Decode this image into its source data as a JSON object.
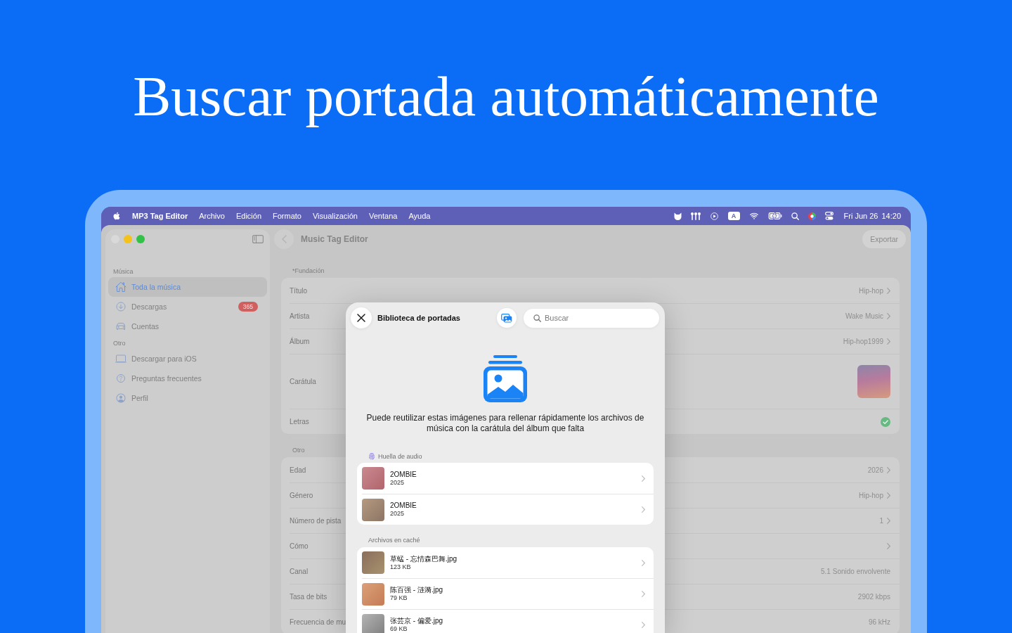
{
  "headline": "Buscar portada automáticamente",
  "menu_bar": {
    "app_name": "MP3 Tag Editor",
    "menus": [
      "Archivo",
      "Edición",
      "Formato",
      "Visualización",
      "Ventana",
      "Ayuda"
    ],
    "input_source": "A",
    "date": "Fri Jun 26",
    "time": "14:20"
  },
  "window": {
    "traffic_lights": [
      {
        "disabled": true
      },
      {
        "disabled": false
      },
      {
        "disabled": false
      }
    ],
    "title": "Music Tag Editor",
    "export_button": {
      "label": "Exportar",
      "disabled": true
    }
  },
  "sidebar": {
    "sections": [
      {
        "heading": "Música",
        "items": [
          {
            "label": "Toda la música",
            "selected": true
          },
          {
            "label": "Descargas",
            "selected": false,
            "badge": "365"
          },
          {
            "label": "Cuentas",
            "selected": false
          }
        ]
      },
      {
        "heading": "Otro",
        "items": [
          {
            "label": "Descargar para iOS",
            "selected": false
          },
          {
            "label": "Preguntas frecuentes",
            "selected": false
          },
          {
            "label": "Perfil",
            "selected": false
          }
        ]
      }
    ]
  },
  "form": {
    "sections": [
      {
        "heading": "*Fundación",
        "rows": [
          {
            "label": "Título",
            "kind": "link",
            "value": "Hip-hop"
          },
          {
            "label": "Artista",
            "kind": "link",
            "value": "Wake Music"
          },
          {
            "label": "Álbum",
            "kind": "link",
            "value": "Hip-hop1999"
          },
          {
            "label": "Carátula",
            "kind": "cover"
          },
          {
            "label": "Letras",
            "kind": "check"
          }
        ]
      },
      {
        "heading": "Otro",
        "rows": [
          {
            "label": "Edad",
            "kind": "link",
            "value": "2026"
          },
          {
            "label": "Género",
            "kind": "link",
            "value": "Hip-hop"
          },
          {
            "label": "Número de pista",
            "kind": "link",
            "value": "1"
          },
          {
            "label": "Cómo",
            "kind": "link"
          },
          {
            "label": "Canal",
            "kind": "value",
            "value": "5.1 Sonido envolvente"
          },
          {
            "label": "Tasa de bits",
            "kind": "value",
            "value": "2902 kbps"
          },
          {
            "label": "Frecuencia de mu",
            "kind": "value",
            "value": "96 kHz"
          }
        ]
      }
    ]
  },
  "cover_library": {
    "title": "Biblioteca de portadas",
    "search": {
      "placeholder": "Buscar"
    },
    "description": "Puede reutilizar estas imágenes para rellenar rápidamente los archivos de música con la carátula del álbum que falta",
    "sections": [
      {
        "heading": "Huella de audio",
        "kind": "match",
        "items": [
          {
            "title": "2OMBIE",
            "subtitle": "2025"
          },
          {
            "title": "2OMBIE",
            "subtitle": "2025"
          }
        ]
      },
      {
        "heading": "Archivos en caché",
        "kind": "cache",
        "items": [
          {
            "title": "草蜢 - 忘情森巴舞.jpg",
            "subtitle": "123 KB"
          },
          {
            "title": "陈百强 - 涟漪.jpg",
            "subtitle": "79 KB"
          },
          {
            "title": "张芸京 - 偏爱.jpg",
            "subtitle": "69 KB"
          }
        ]
      }
    ]
  }
}
